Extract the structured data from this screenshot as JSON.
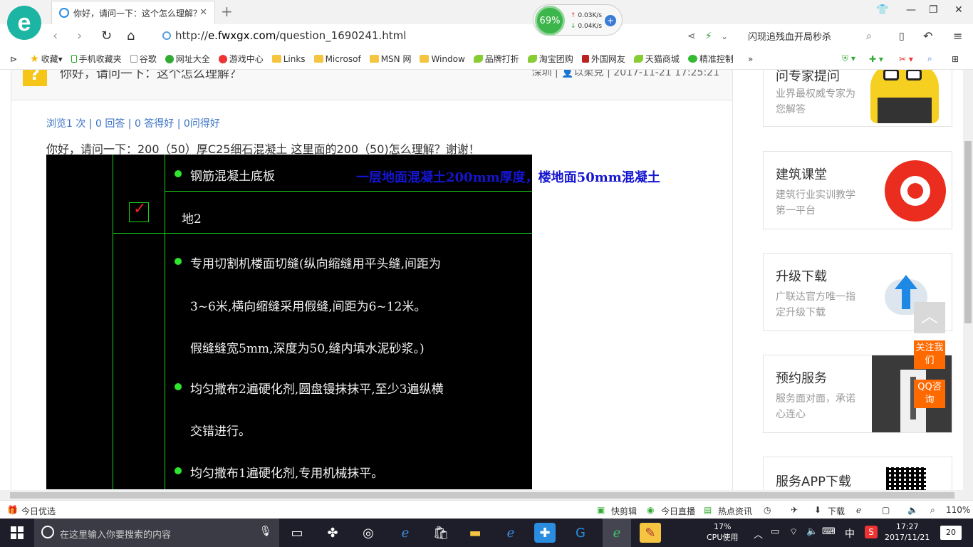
{
  "browser": {
    "tab_title": "你好，请问一下：这个怎么理解？",
    "url_prefix": "http://",
    "url_domain": "e.fwxgx.com",
    "url_path": "/question_1690241.html",
    "search_text": "闪现追残血开局秒杀",
    "net": {
      "percent": "69%",
      "up": "0.03K/s",
      "down": "0.04K/s"
    }
  },
  "bookmarks": [
    {
      "label": "收藏",
      "icon": "star-icon"
    },
    {
      "label": "手机收藏夹",
      "icon": "phone-icon"
    },
    {
      "label": "谷歌",
      "icon": "page-icon"
    },
    {
      "label": "网址大全",
      "icon": "globe-icon"
    },
    {
      "label": "游戏中心",
      "icon": "game-icon"
    },
    {
      "label": "Links",
      "icon": "folder-icon"
    },
    {
      "label": "Microsof",
      "icon": "folder-icon"
    },
    {
      "label": "MSN 网",
      "icon": "folder-icon"
    },
    {
      "label": "Window",
      "icon": "folder-icon"
    },
    {
      "label": "品牌打折",
      "icon": "leaf-icon"
    },
    {
      "label": "淘宝团购",
      "icon": "leaf-icon"
    },
    {
      "label": "外国网友",
      "icon": "flag-icon"
    },
    {
      "label": "天猫商城",
      "icon": "leaf-icon"
    },
    {
      "label": "精准控制",
      "icon": "chat-icon"
    }
  ],
  "question": {
    "title": "你好，请问一下：这个怎么理解？",
    "location": "深圳",
    "user": "以柔克",
    "datetime": "2017-11-21 17:25:21",
    "stats": "浏览1 次 | 0 回答 | 0 答得好 | 0问得好",
    "body": "你好，请问一下：200（50）厚C25细石混凝土    这里面的200（50)怎么理解？谢谢！",
    "annotation": "一层地面混凝土200mm厚度，楼地面50mm混凝土",
    "cad": {
      "row1": "钢筋混凝土底板",
      "row2": "地2",
      "lines": [
        "专用切割机楼面切缝(纵向缩缝用平头缝,间距为",
        "3~6米,横向缩缝采用假缝,间距为6~12米。",
        "假缝缝宽5mm,深度为50,缝内填水泥砂浆。)",
        "均匀撒布2遍硬化剂,圆盘镘抹抹平,至少3遍纵横",
        "交错进行。",
        "均匀撒布1遍硬化剂,专用机械抹平。"
      ]
    }
  },
  "sidebar": {
    "cards": [
      {
        "title": "问专家提问",
        "sub": "业界最权威专家为您解答"
      },
      {
        "title": "建筑课堂",
        "sub": "建筑行业实训教学第一平台"
      },
      {
        "title": "升级下载",
        "sub": "广联达官方唯一指定升级下载"
      },
      {
        "title": "预约服务",
        "sub": "服务面对面，承诺心连心"
      },
      {
        "title": "服务APP下载",
        "sub": ""
      }
    ],
    "follow": "关注我们",
    "qq": "QQ咨询"
  },
  "statusbar": {
    "left": "今日优选",
    "items": [
      "快剪辑",
      "今日直播",
      "热点资讯",
      "下载"
    ],
    "zoom": "110%"
  },
  "taskbar": {
    "search_placeholder": "在这里输入你要搜索的内容",
    "cpu_pct": "17%",
    "cpu_label": "CPU使用",
    "ime": "中",
    "time": "17:27",
    "date": "2017/11/21",
    "notif": "20"
  }
}
